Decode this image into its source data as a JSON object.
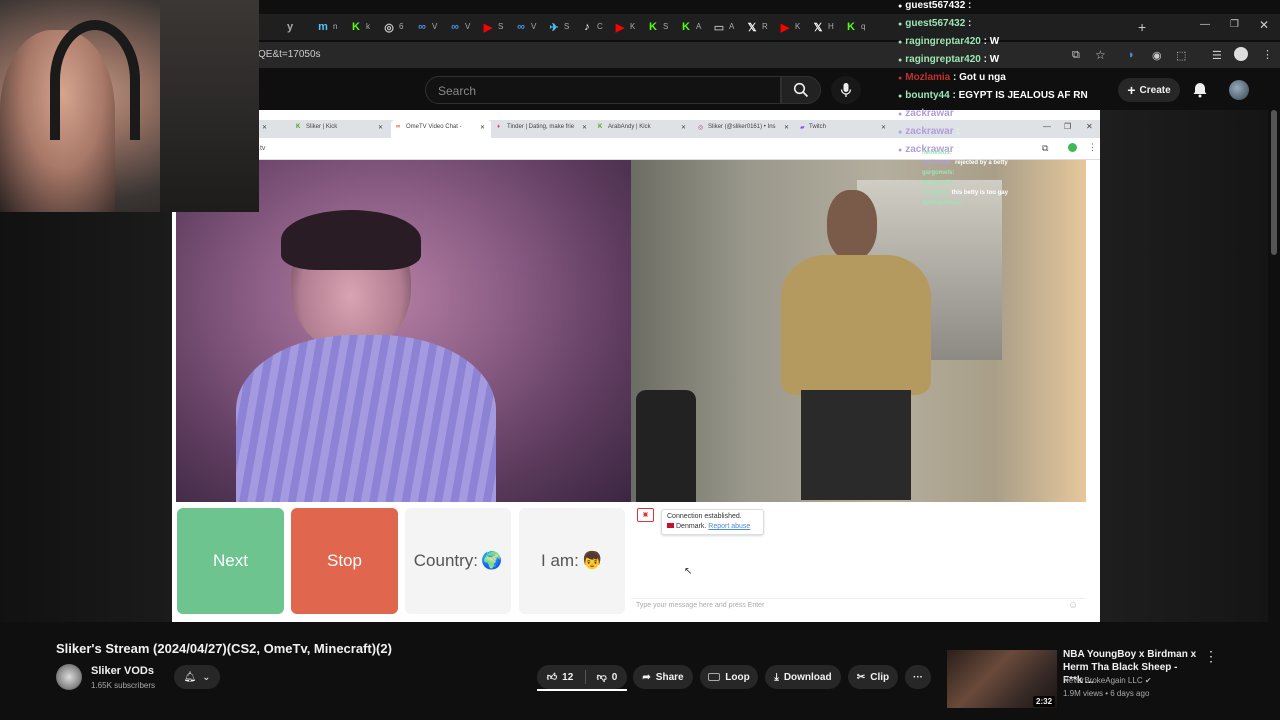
{
  "browser": {
    "tabs": [
      {
        "icon": "y",
        "color": "#aaaaaa",
        "label": ""
      },
      {
        "icon": "m",
        "color": "#4fc3f7",
        "label": "n"
      },
      {
        "icon": "K",
        "color": "#53fc18",
        "label": "k"
      },
      {
        "icon": "◎",
        "color": "#cccccc",
        "label": "6"
      },
      {
        "icon": "∞",
        "color": "#4a90e2",
        "label": "V"
      },
      {
        "icon": "∞",
        "color": "#4a90e2",
        "label": "V"
      },
      {
        "icon": "▶",
        "color": "#ff0000",
        "label": "S"
      },
      {
        "icon": "∞",
        "color": "#4a90e2",
        "label": "V"
      },
      {
        "icon": "✈",
        "color": "#4fc3f7",
        "label": "S"
      },
      {
        "icon": "♪",
        "color": "#ffffff",
        "label": "C"
      },
      {
        "icon": "▶",
        "color": "#ff0000",
        "label": "K"
      },
      {
        "icon": "K",
        "color": "#53fc18",
        "label": "S"
      },
      {
        "icon": "K",
        "color": "#53fc18",
        "label": "A"
      },
      {
        "icon": "▭",
        "color": "#aaaaaa",
        "label": "A"
      },
      {
        "icon": "𝕏",
        "color": "#ffffff",
        "label": "R"
      },
      {
        "icon": "▶",
        "color": "#ff0000",
        "label": "K"
      },
      {
        "icon": "𝕏",
        "color": "#ffffff",
        "label": "H"
      },
      {
        "icon": "K",
        "color": "#53fc18",
        "label": "q"
      }
    ],
    "url": "QE&t=17050s"
  },
  "youtube": {
    "search_placeholder": "Search",
    "create_label": "Create"
  },
  "inner_browser": {
    "tabs": [
      "Sliker | Kick",
      "OmeTV Video Chat -",
      "Tinder | Dating, make frie",
      "ArabAndy | Kick",
      "Sliker (@sliker0161) • Ins",
      "Twitch"
    ],
    "url": ".tv"
  },
  "ometv": {
    "next_label": "Next",
    "stop_label": "Stop",
    "country_label": "Country:",
    "country_icon": "🌍",
    "iam_label": "I am:",
    "iam_icon": "👦",
    "connection_text": "Connection established.",
    "country_name": "Denmark.",
    "report_label": "Report abuse",
    "message_placeholder": "Type your message here and press Enter"
  },
  "stream_chat": [
    {
      "user": "guest567432",
      "text": "",
      "color": "#ffffff"
    },
    {
      "user": "guest567432",
      "text": "",
      "color": "#9ae6b4"
    },
    {
      "user": "ragingreptar420",
      "text": "W",
      "color": "#9ae6b4"
    },
    {
      "user": "ragingreptar420",
      "text": "W",
      "color": "#9ae6b4"
    },
    {
      "user": "Mozlamia",
      "text": "Got u nga",
      "color": "#c03030"
    },
    {
      "user": "bounty44",
      "text": "EGYPT IS JEALOUS AF RN",
      "color": "#9ae6b4"
    },
    {
      "user": "zackrawar",
      "text": "",
      "color": "#b39ddb"
    },
    {
      "user": "zackrawar",
      "text": "",
      "color": "#b39ddb"
    },
    {
      "user": "zackrawar",
      "text": "",
      "color": "#b39ddb"
    }
  ],
  "stream_chat_small": [
    {
      "user": "nemesius:",
      "text": "is be full or half arab?",
      "color": "#9ae6b4"
    },
    {
      "user": "zackrawar:",
      "text": "rejected by a betty",
      "color": "#b39ddb"
    },
    {
      "user": "gargomels:",
      "text": "",
      "color": "#9ae6b4"
    },
    {
      "user": "gargomels:",
      "text": "",
      "color": "#9ae6b4"
    },
    {
      "user": "Twilighty:",
      "text": "this betty is too gay",
      "color": "#9ae6b4"
    },
    {
      "user": "Speedofsoon:",
      "text": "",
      "color": "#9ae6b4"
    }
  ],
  "video": {
    "title": "Sliker's Stream (2024/04/27)(CS2, OmeTv, Minecraft)(2)",
    "channel_name": "Sliker VODs",
    "subscribers": "1.65K subscribers",
    "likes": "12",
    "dislikes": "0",
    "share_label": "Share",
    "loop_label": "Loop",
    "download_label": "Download",
    "clip_label": "Clip",
    "more_label": "···"
  },
  "recommended": {
    "title": "NBA YoungBoy x Birdman x Herm Tha Black Sheep - F**k ...",
    "channel": "NeverBrokeAgain LLC",
    "meta": "1.9M views • 6 days ago",
    "duration": "2:32"
  },
  "colors": {
    "next": "#6dc48f",
    "stop": "#e0674d",
    "kick": "#53fc18",
    "youtube_red": "#ff0000"
  }
}
